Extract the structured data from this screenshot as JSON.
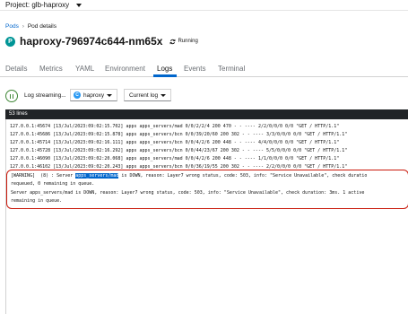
{
  "header": {
    "project_label": "Project: glb-haproxy"
  },
  "breadcrumb": {
    "parent": "Pods",
    "current": "Pod details"
  },
  "pod": {
    "badge": "P",
    "name": "haproxy-796974c644-nm65x",
    "status": "Running"
  },
  "tabs": [
    {
      "label": "Details"
    },
    {
      "label": "Metrics"
    },
    {
      "label": "YAML"
    },
    {
      "label": "Environment"
    },
    {
      "label": "Logs",
      "active": true
    },
    {
      "label": "Events"
    },
    {
      "label": "Terminal"
    }
  ],
  "toolbar": {
    "streaming_label": "Log streaming...",
    "container_badge": "C",
    "container_value": "haproxy",
    "log_select_value": "Current log"
  },
  "console": {
    "line_count": "53 lines",
    "lines": [
      "127.0.0.1:45674 [13/Jul/2023:09:02:15.702] apps apps_servers/mad 0/0/2/2/4 200 470 - - ---- 2/2/0/0/0 0/0 \"GET / HTTP/1.1\"",
      "127.0.0.1:45686 [13/Jul/2023:09:02:15.878] apps apps_servers/bcn 0/0/39/20/60 200 302 - - ---- 3/3/0/0/0 0/0 \"GET / HTTP/1.1\"",
      "127.0.0.1:45714 [13/Jul/2023:09:02:16.111] apps apps_servers/bcn 0/0/4/2/6 200 448 - - ---- 4/4/0/0/0 0/0 \"GET / HTTP/1.1\"",
      "127.0.0.1:45728 [13/Jul/2023:09:02:16.292] apps apps_servers/bcn 0/0/44/23/67 200 302 - - ---- 5/5/0/0/0 0/0 \"GET / HTTP/1.1\"",
      "127.0.0.1:46090 [13/Jul/2023:09:02:20.068] apps apps_servers/mad 0/0/4/2/6 200 448 - - ---- 1/1/0/0/0 0/0 \"GET / HTTP/1.1\"",
      "127.0.0.1:46102 [13/Jul/2023:09:02:20.243] apps apps_servers/bcn 0/0/36/19/55 200 302 - - ---- 2/2/0/0/0 0/0 \"GET / HTTP/1.1\""
    ],
    "warning": {
      "prefix": "[WARNING]  (8) : Server ",
      "highlight": "apps_servers/mad",
      "suffix_1": " is DOWN, reason: Layer7 wrong status, code: 503, info: \"Service Unavailable\", check duratio",
      "line_2": "requeued, 0 remaining in queue.",
      "line_3": "Server apps_servers/mad is DOWN, reason: Layer7 wrong status, code: 503, info: \"Service Unavailable\", check duration: 3ms. 1 active",
      "line_4": "remaining in queue."
    }
  },
  "colors": {
    "accent": "#0066cc",
    "running": "#3e8635",
    "warning_border": "#c9190b",
    "console_header": "#212427"
  }
}
